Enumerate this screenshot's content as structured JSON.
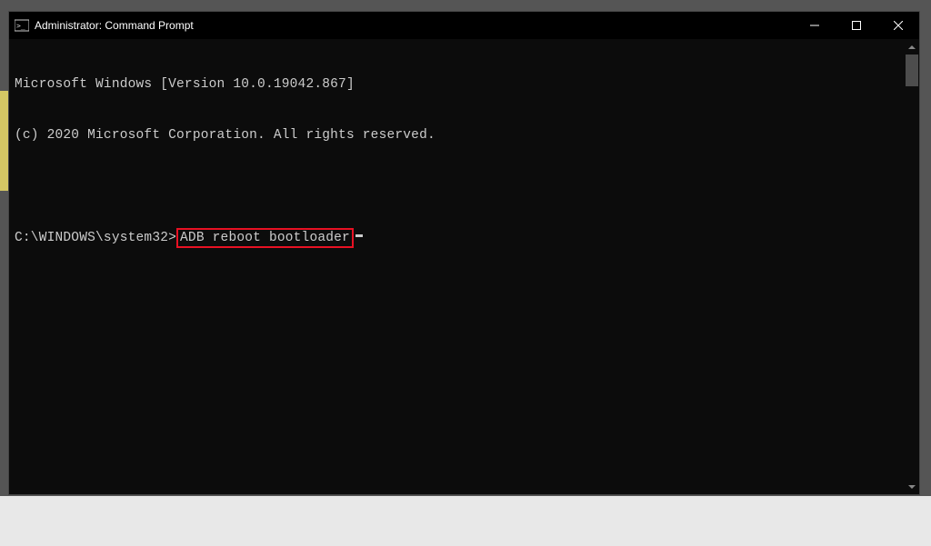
{
  "window": {
    "title": "Administrator: Command Prompt"
  },
  "terminal": {
    "line1": "Microsoft Windows [Version 10.0.19042.867]",
    "line2": "(c) 2020 Microsoft Corporation. All rights reserved.",
    "prompt": "C:\\WINDOWS\\system32>",
    "command": "ADB reboot bootloader"
  }
}
